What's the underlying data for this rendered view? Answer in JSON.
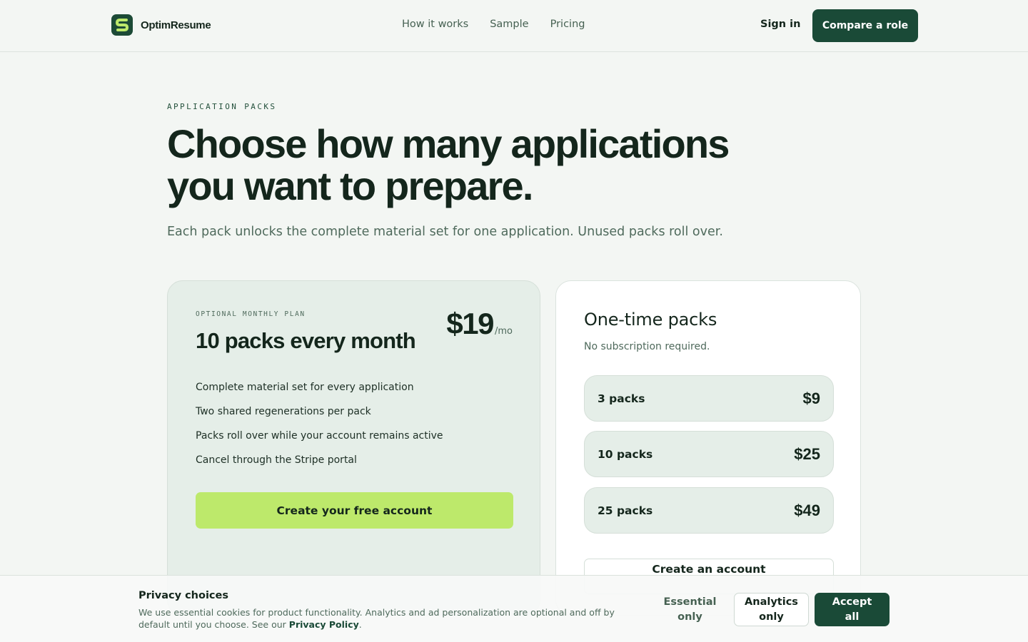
{
  "header": {
    "brand_name": "OptimResume",
    "nav": [
      "How it works",
      "Sample",
      "Pricing"
    ],
    "signin_label": "Sign in",
    "cta_label": "Compare a role"
  },
  "hero": {
    "eyebrow": "APPLICATION PACKS",
    "title_line1": "Choose how many applications",
    "title_line2": "you want to prepare.",
    "subtitle": "Each pack unlocks the complete material set for one application. Unused packs roll over."
  },
  "monthly": {
    "label": "OPTIONAL MONTHLY PLAN",
    "title": "10 packs every month",
    "price": "$19",
    "period": "/mo",
    "features": [
      "Complete material set for every application",
      "Two shared regenerations per pack",
      "Packs roll over while your account remains active",
      "Cancel through the Stripe portal"
    ],
    "button_label": "Create your free account"
  },
  "onetime": {
    "title": "One-time packs",
    "subtitle": "No subscription required.",
    "packs": [
      {
        "name": "3 packs",
        "price": "$9"
      },
      {
        "name": "10 packs",
        "price": "$25"
      },
      {
        "name": "25 packs",
        "price": "$49"
      }
    ],
    "button_label": "Create an account"
  },
  "cookie": {
    "title": "Privacy choices",
    "text": "We use essential cookies for product functionality. Analytics and ad personalization are optional and off by default until you choose. See our ",
    "link_label": "Privacy Policy",
    "text_end": ".",
    "essential_line1": "Essential",
    "essential_line2": "only",
    "analytics_line1": "Analytics",
    "analytics_line2": "only",
    "accept_line1": "Accept",
    "accept_line2": "all"
  },
  "colors": {
    "brand_dark": "#1a4a37",
    "lime": "#bde96b",
    "background": "#f3f6f3",
    "card_tint": "#e5eee8"
  },
  "icons": {
    "logo": "brand-logo-icon"
  }
}
